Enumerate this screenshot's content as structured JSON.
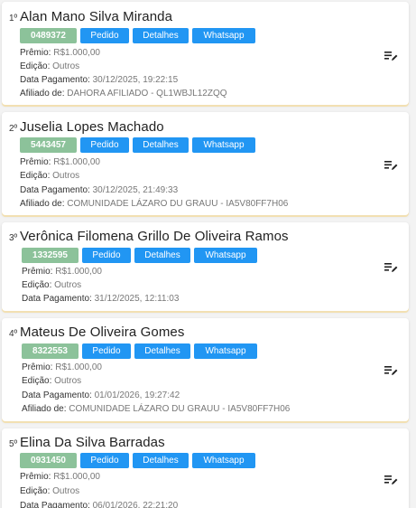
{
  "labels": {
    "premio": "Prêmio:",
    "edicao": "Edição:",
    "pagamento": "Data Pagamento:",
    "afiliado": "Afiliado de:",
    "pedido": "Pedido",
    "detalhes": "Detalhes",
    "whatsapp": "Whatsapp"
  },
  "icons": {
    "edit": "edit-list-icon"
  },
  "colors": {
    "id_badge": "#8cc29a",
    "button": "#2196f3",
    "card_shadow": "#f2e0b2"
  },
  "winners": [
    {
      "rank": "1º",
      "name": "Alan Mano Silva Miranda",
      "id": "0489372",
      "premio": "R$1.000,00",
      "edicao": "Outros",
      "pagamento": "30/12/2025, 19:22:15",
      "afiliado": "DAHORA AFILIADO - QL1WBJL12ZQQ"
    },
    {
      "rank": "2º",
      "name": "Juselia Lopes Machado",
      "id": "5443457",
      "premio": "R$1.000,00",
      "edicao": "Outros",
      "pagamento": "30/12/2025, 21:49:33",
      "afiliado": "COMUNIDADE LÁZARO DU GRAUU - IA5V80FF7H06"
    },
    {
      "rank": "3º",
      "name": "Verônica Filomena Grillo De Oliveira Ramos",
      "id": "1332595",
      "premio": "R$1.000,00",
      "edicao": "Outros",
      "pagamento": "31/12/2025, 12:11:03"
    },
    {
      "rank": "4º",
      "name": "Mateus De Oliveira Gomes",
      "id": "8322553",
      "premio": "R$1.000,00",
      "edicao": "Outros",
      "pagamento": "01/01/2026, 19:27:42",
      "afiliado": "COMUNIDADE LÁZARO DU GRAUU - IA5V80FF7H06"
    },
    {
      "rank": "5º",
      "name": "Elina Da Silva Barradas",
      "id": "0931450",
      "premio": "R$1.000,00",
      "edicao": "Outros",
      "pagamento": "06/01/2026, 22:21:20"
    }
  ]
}
